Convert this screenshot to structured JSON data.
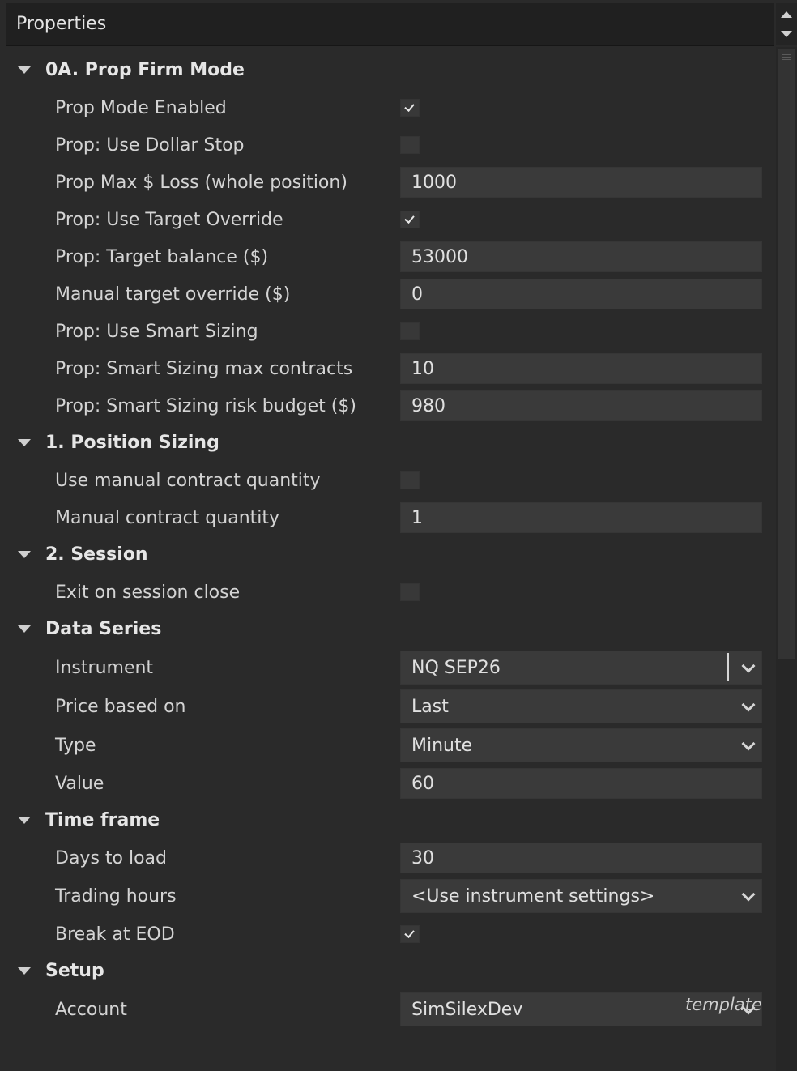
{
  "header": {
    "title": "Properties"
  },
  "categories": [
    {
      "label": "0A. Prop Firm Mode",
      "props": [
        {
          "label": "Prop Mode Enabled",
          "kind": "checkbox",
          "checked": true
        },
        {
          "label": "Prop: Use Dollar Stop",
          "kind": "checkbox",
          "checked": false
        },
        {
          "label": "Prop Max $ Loss (whole position)",
          "kind": "text",
          "value": "1000"
        },
        {
          "label": "Prop: Use Target Override",
          "kind": "checkbox",
          "checked": true
        },
        {
          "label": "Prop: Target balance ($)",
          "kind": "text",
          "value": "53000"
        },
        {
          "label": "Manual target override ($)",
          "kind": "text",
          "value": "0"
        },
        {
          "label": "Prop: Use Smart Sizing",
          "kind": "checkbox",
          "checked": false
        },
        {
          "label": "Prop: Smart Sizing max contracts",
          "kind": "text",
          "value": "10"
        },
        {
          "label": "Prop: Smart Sizing risk budget ($)",
          "kind": "text",
          "value": "980"
        }
      ]
    },
    {
      "label": "1. Position Sizing",
      "props": [
        {
          "label": "Use manual contract quantity",
          "kind": "checkbox",
          "checked": false
        },
        {
          "label": "Manual contract quantity",
          "kind": "text",
          "value": "1"
        }
      ]
    },
    {
      "label": "2. Session",
      "props": [
        {
          "label": "Exit on session close",
          "kind": "checkbox",
          "checked": false
        }
      ]
    },
    {
      "label": "Data Series",
      "props": [
        {
          "label": "Instrument",
          "kind": "combo",
          "value": "NQ SEP26"
        },
        {
          "label": "Price based on",
          "kind": "select",
          "value": "Last"
        },
        {
          "label": "Type",
          "kind": "select",
          "value": "Minute"
        },
        {
          "label": "Value",
          "kind": "text",
          "value": "60"
        }
      ]
    },
    {
      "label": "Time frame",
      "props": [
        {
          "label": "Days to load",
          "kind": "text",
          "value": "30"
        },
        {
          "label": "Trading hours",
          "kind": "select",
          "value": "<Use instrument settings>"
        },
        {
          "label": "Break at EOD",
          "kind": "checkbox",
          "checked": true
        }
      ]
    },
    {
      "label": "Setup",
      "props": [
        {
          "label": "Account",
          "kind": "select",
          "value": "SimSilexDev"
        }
      ]
    }
  ],
  "footer": {
    "template_label": "template"
  },
  "icons": {
    "expand": "triangle-down-icon",
    "checkmark": "check-icon",
    "dropdown": "chevron-down-icon",
    "scroll_up": "scroll-up-arrow-icon",
    "scroll_down": "scroll-down-arrow-icon"
  },
  "colors": {
    "panel_background": "#2a2a2a",
    "header_background": "#202020",
    "field_background": "#3a3a3a",
    "text": "#d4d4d4"
  }
}
